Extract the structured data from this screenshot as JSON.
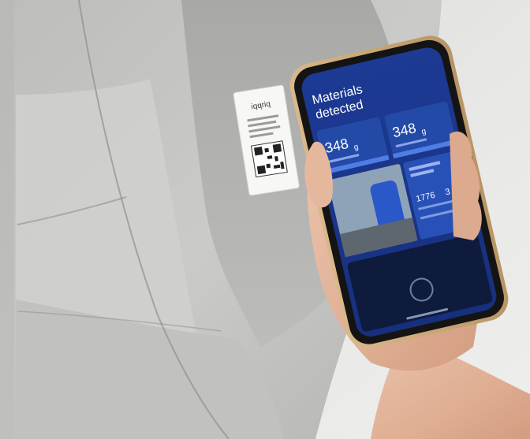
{
  "label": {
    "brand": "iqqriq"
  },
  "phone_screen": {
    "title_line1": "Materials",
    "title_line2": "detected",
    "stat_left_value": "348",
    "stat_left_sub": "g",
    "stat_right_value": "348",
    "stat_right_sub": "g",
    "small_stat_1": "1776",
    "small_stat_2": "3"
  },
  "colors": {
    "wall": "#e7e7e5",
    "garment": "#c6c6c4",
    "phone_blue": "#1f3d96",
    "phone_blue_light": "#2e56c2"
  }
}
